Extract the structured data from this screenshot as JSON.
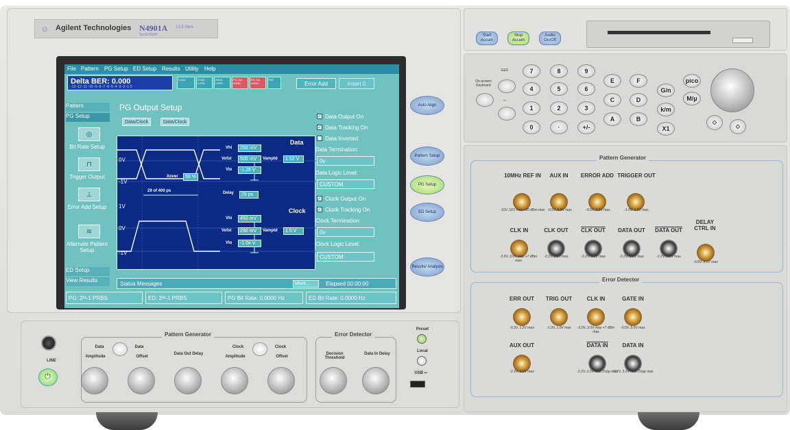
{
  "brand": {
    "logo": "☼",
    "name": "Agilent Technologies",
    "model": "N4901A",
    "model_sub": "13.5 Gb/s",
    "model_sub2": "Serial BERT"
  },
  "menu": [
    "File",
    "Pattern",
    "PG Setup",
    "ED Setup",
    "Results",
    "Utility",
    "Help"
  ],
  "ber": {
    "label": "Delta BER: 0.000",
    "scale": "-13 -12 -11 -10 -9 -8 -7 -6 -5 -4 -3 -2 -1 0"
  },
  "status_indicators": [
    "Errors",
    "SYNC LOSS",
    "DATA LOSS",
    "PG Out dGND",
    "ED Out dGND",
    "PAT"
  ],
  "buttons": {
    "error_add": "Error Add",
    "insert": "Insert 0"
  },
  "sidebar": {
    "pattern": "Pattern",
    "pg_setup": "PG Setup",
    "items": [
      {
        "label": "Bit Rate Setup",
        "icon": "dial-icon",
        "glyph": "◎"
      },
      {
        "label": "Trigger Output",
        "icon": "trigger-icon",
        "glyph": "⊓"
      },
      {
        "label": "Error Add Setup",
        "icon": "error-add-icon",
        "glyph": "⊥"
      },
      {
        "label": "Alternate Pattern Setup",
        "icon": "alternate-icon",
        "glyph": "≋"
      }
    ],
    "ed_setup": "ED Setup",
    "view_results": "View Results"
  },
  "main": {
    "title": "PG Output Setup",
    "tabs": [
      "Data/Clock",
      "Data/Clock"
    ],
    "data_label": "Data",
    "clock_label": "Clock",
    "data": {
      "vhi": "250 mV",
      "vohi": "500 mV",
      "vlo": "-1.26 V",
      "vamptd": "1.52 V",
      "xover": "50 %",
      "delay": "29 ps",
      "bits": "29 of 400 ps"
    },
    "clock": {
      "vhi": "450 mV",
      "vohi": "290 mV",
      "vlo": "-1.04 V",
      "vamptd": "1.5 V"
    },
    "field_labels": {
      "vhi": "Vhi",
      "vohi": "Vofst",
      "vlo": "Vlo",
      "vamptd": "Vamptd",
      "xover": "Xover",
      "delay": "Delay"
    },
    "axis": {
      "zero": "0V",
      "minus_one": "-1V",
      "plus_one": "1V"
    }
  },
  "options": {
    "data_output_on": "Data Output On",
    "data_tracking_on": "Data Tracking On",
    "data_inverted": "Data Inverted",
    "data_termination_label": "Data Termination:",
    "data_termination_value": "0v",
    "data_logic_label": "Data Logic Level:",
    "data_logic_value": "CUSTOM",
    "clock_output_on": "Clock Output On",
    "clock_tracking_on": "Clock Tracking On",
    "clock_termination_label": "Clock Termination:",
    "clock_termination_value": "0v",
    "clock_logic_label": "Clock Logic Level:",
    "clock_logic_value": "CUSTOM"
  },
  "statusbar": {
    "label": "Status Messages",
    "more": "More...",
    "elapsed": "Elapsed 00:00:00"
  },
  "footer": {
    "pg": "PG: 2²³-1 PRBS",
    "ed": "ED: 2²³-1 PRBS",
    "pg_rate": "PG Bit Rate: 0.0000 Hz",
    "ed_rate": "ED Bit Rate: 0.0000 Hz"
  },
  "soft_keys": [
    "Auto Align",
    "Pattern Setup",
    "PG Setup",
    "ED Setup",
    "Results/ Analysis"
  ],
  "top_buttons": [
    "Start Accum",
    "Stop Accum",
    "Audio On/Off"
  ],
  "keypad": {
    "onscreen": "On-screen Keyboard",
    "eex": "EEX",
    "minus": "—",
    "digits": [
      "7",
      "8",
      "9",
      "4",
      "5",
      "6",
      "1",
      "2",
      "3",
      "0",
      "·",
      "+/-"
    ],
    "hex": [
      "E",
      "F",
      "C",
      "D",
      "A",
      "B"
    ],
    "units": [
      "G/n",
      "k/m",
      "X1"
    ],
    "units2": [
      "pico",
      "M/µ"
    ]
  },
  "pattern_generator": {
    "title": "Pattern Generator",
    "row1": [
      {
        "label": "10MHz REF IN",
        "spec": "-10V..10V max +20 dBm max"
      },
      {
        "label": "AUX IN",
        "spec": "-0.5V..5.5V max"
      },
      {
        "label": "ERROR ADD",
        "spec": "-0.5V..5.5V max"
      },
      {
        "label": "TRIGGER OUT",
        "spec": "-1.0V..1.0V max"
      }
    ],
    "row2": [
      {
        "label": "CLK IN",
        "spec": "-3.0V..3.0V max +7 dBm max"
      },
      {
        "label": "CLK OUT",
        "spec": "-2.2V..3.2V max"
      },
      {
        "label": "CLK OUT",
        "spec": "-2.2V..3.2V max"
      },
      {
        "label": "DATA OUT",
        "spec": "-2.2V..3.2V max"
      },
      {
        "label": "DATA OUT",
        "spec": "-2.2V..3.2V max"
      },
      {
        "label": "DELAY CTRL IN",
        "spec": "-0.5V..6.5V max"
      }
    ]
  },
  "error_detector": {
    "title": "Error Detector",
    "row1": [
      {
        "label": "ERR OUT",
        "spec": "-0.2V..1.2V max"
      },
      {
        "label": "TRIG OUT",
        "spec": "-1.0V..1.0V max"
      },
      {
        "label": "CLK IN",
        "spec": "-3.0V..3.0V max +7 dBm max"
      },
      {
        "label": "GATE IN",
        "spec": "-0.5V..5.0V max"
      }
    ],
    "row2": [
      {
        "label": "AUX OUT",
        "spec": "-2.2V..3.2V max"
      },
      {
        "label": "DATA IN",
        "spec": "-2.2V..3.2V max 2Vpp max"
      },
      {
        "label": "DATA IN",
        "spec": "-2.2V..3.2V max 2Vpp max"
      }
    ]
  },
  "front_bottom": {
    "line": "LINE",
    "pg_title": "Pattern Generator",
    "ed_title": "Error Detector",
    "knobs": [
      "Amplitude",
      "Offset",
      "Data Out Delay",
      "Amplitude",
      "Offset",
      "Decision Threshold",
      "Data In Delay"
    ],
    "toggle_labels": [
      "Data",
      "Data",
      "Clock",
      "Clock"
    ],
    "preset": "Preset",
    "local": "Local",
    "usb": "USB ⭠"
  }
}
